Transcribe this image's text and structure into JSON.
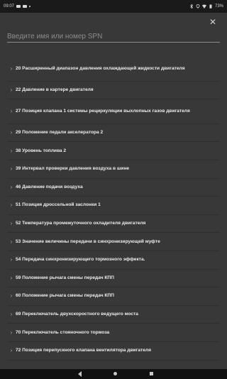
{
  "status_bar": {
    "time": "09:07",
    "battery": "73%",
    "icons": [
      "notification-icon",
      "notification-icon",
      "dot-icon",
      "bluetooth-icon",
      "location-icon",
      "wifi-icon",
      "battery-icon"
    ]
  },
  "dialog": {
    "close_icon": "✕",
    "search": {
      "placeholder": "Введите имя или номер SPN",
      "value": ""
    },
    "items": [
      {
        "label": "20 Расширенный диапазон давления охлаждающей жидкости двигателя"
      },
      {
        "label": "22 Давление  в картере двигателя"
      },
      {
        "label": "27 Позиция клапана 1 системы рециркуляции выхлопных газов двигателя"
      },
      {
        "label": "29 Положение педали акселератора 2"
      },
      {
        "label": "38 Уровень топлива 2"
      },
      {
        "label": "39 Интервал проверки давления воздуха в шине"
      },
      {
        "label": "46 Давление подачи воздуха"
      },
      {
        "label": "51 Позиция дроссельной заслонки 1"
      },
      {
        "label": "52 Температура  промежуточного охладителя двигателя"
      },
      {
        "label": "53 Значение величины передачи в синхронизирующей муфте"
      },
      {
        "label": "54 Передача синхронизирующего тормозного эффекта."
      },
      {
        "label": "59 Положение рычага смены передач КПП"
      },
      {
        "label": "60 Положение рычага смены передач КПП"
      },
      {
        "label": "69 Переключатель двухскоростного ведущего моста"
      },
      {
        "label": "70 Переключатель стояночного тормоза"
      },
      {
        "label": "72 Позиция перепускного клапана вентилятора двигателя"
      }
    ]
  },
  "nav_bar": {
    "icons": [
      "back-icon",
      "home-icon",
      "recents-icon"
    ]
  },
  "colors": {
    "status_bar_bg": "#1a1a1a",
    "dialog_bg": "#383838",
    "text": "#ededed",
    "placeholder": "#8c8c8c",
    "nav_bar_bg": "#111111"
  }
}
